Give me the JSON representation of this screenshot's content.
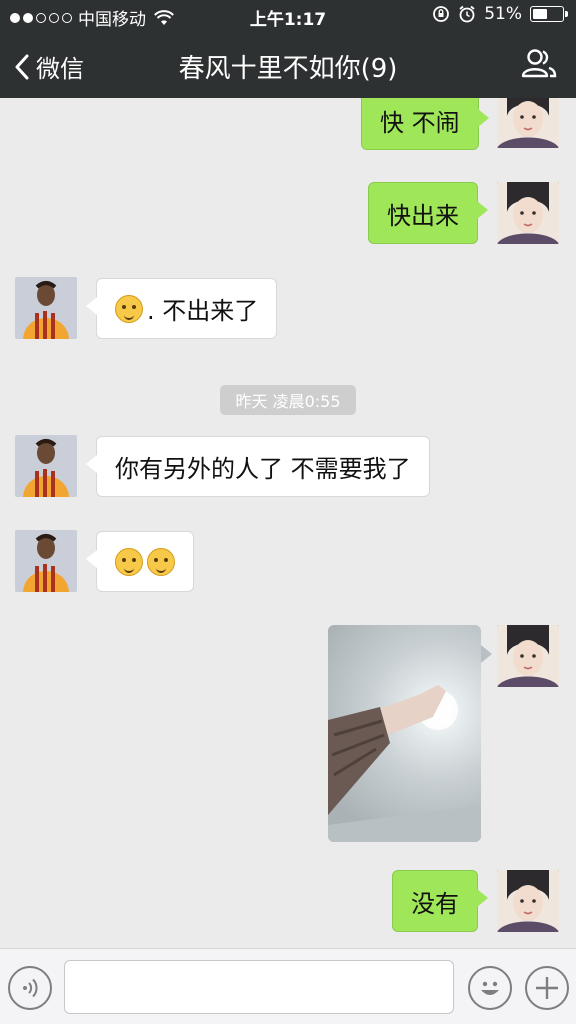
{
  "status_bar": {
    "carrier": "中国移动",
    "time": "上午1:17",
    "battery": "51%",
    "battery_level": 0.51
  },
  "nav": {
    "back_label": "微信",
    "title": "春风十里不如你(9)",
    "back_icon": "chevron-left-icon",
    "group_icon": "group-members-icon"
  },
  "messages": [
    {
      "side": "me",
      "type": "text",
      "text": "快 不闹"
    },
    {
      "side": "me",
      "type": "text",
      "text": "快出来"
    },
    {
      "side": "other",
      "type": "emoji_text",
      "emoji": "thinking-emoji",
      "text": ". 不出来了"
    },
    {
      "type": "timestamp",
      "text": "昨天 凌晨0:55"
    },
    {
      "side": "other",
      "type": "text",
      "text": "你有另外的人了 不需要我了"
    },
    {
      "side": "other",
      "type": "emoji",
      "emojis": [
        "shy-emoji",
        "shy-emoji"
      ]
    },
    {
      "side": "me",
      "type": "image",
      "description": "photo-hand"
    },
    {
      "side": "me",
      "type": "text",
      "text": "没有"
    }
  ],
  "input_bar": {
    "voice_icon": "voice-icon",
    "emoji_icon": "emoji-icon",
    "plus_icon": "plus-icon",
    "placeholder": ""
  },
  "colors": {
    "nav_bg": "#2e3132",
    "chat_bg": "#ebebeb",
    "my_bubble": "#9fe658",
    "other_bubble": "#ffffff"
  }
}
